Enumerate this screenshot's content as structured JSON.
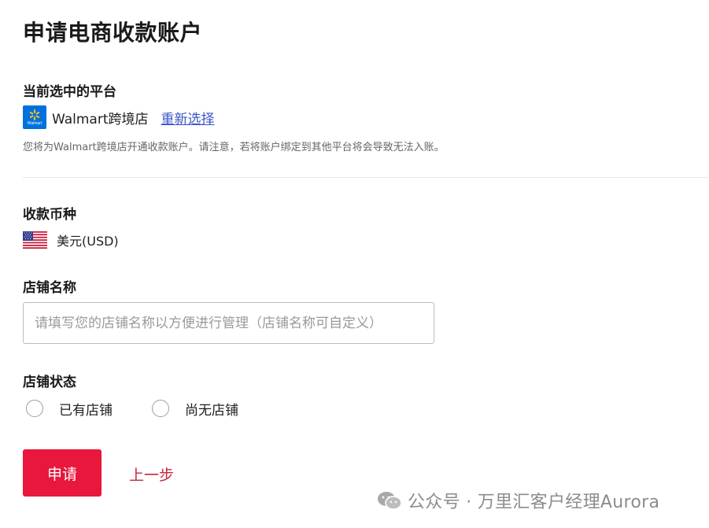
{
  "page": {
    "title": "申请电商收款账户"
  },
  "platform": {
    "section_label": "当前选中的平台",
    "logo_text": "Walmart",
    "name": "Walmart跨境店",
    "reselect_label": "重新选择",
    "notice": "您将为Walmart跨境店开通收款账户。请注意，若将账户绑定到其他平台将会导致无法入账。"
  },
  "currency": {
    "section_label": "收款币种",
    "flag_icon": "us-flag-icon",
    "value": "美元(USD)"
  },
  "store_name": {
    "section_label": "店铺名称",
    "value": "",
    "placeholder": "请填写您的店铺名称以方便进行管理（店铺名称可自定义）"
  },
  "store_status": {
    "section_label": "店铺状态",
    "options": [
      {
        "label": "已有店铺",
        "selected": false
      },
      {
        "label": "尚无店铺",
        "selected": false
      }
    ]
  },
  "actions": {
    "submit_label": "申请",
    "back_label": "上一步"
  },
  "watermark": {
    "icon": "wechat-icon",
    "text": "公众号 · 万里汇客户经理Aurora"
  },
  "colors": {
    "primary": "#e8173b",
    "link": "#3b55c7",
    "back_link": "#c9243f",
    "walmart_blue": "#0071dc",
    "walmart_yellow": "#ffc220"
  }
}
